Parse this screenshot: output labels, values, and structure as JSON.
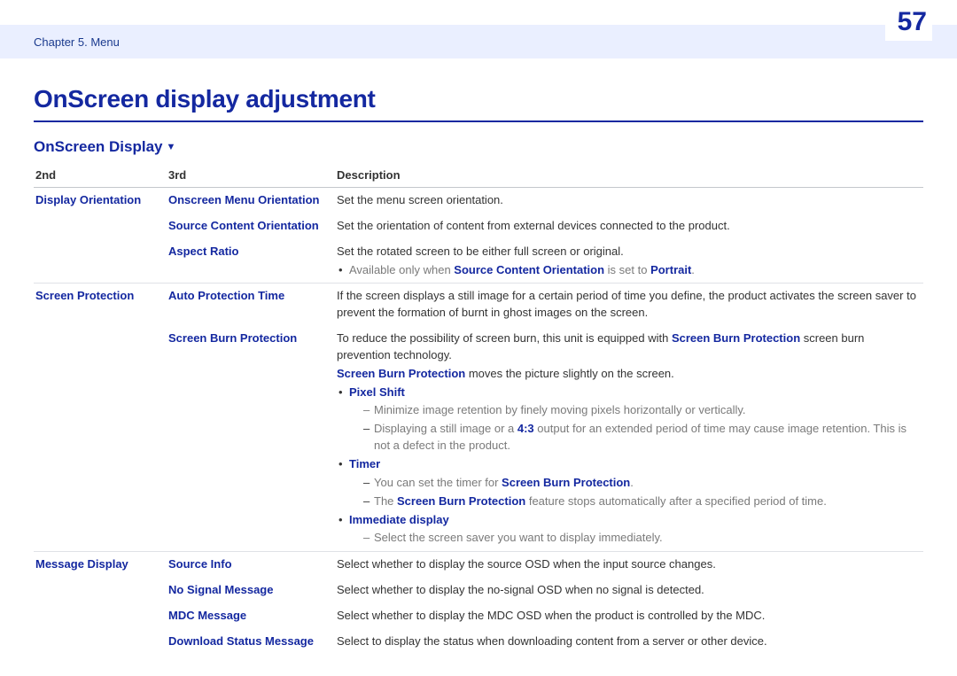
{
  "page_number": "57",
  "breadcrumb": "Chapter 5.  Menu",
  "title": "OnScreen display adjustment",
  "section_title": "OnScreen Display",
  "headers": {
    "c2": "2nd",
    "c3": "3rd",
    "desc": "Description"
  },
  "rows": {
    "display_orientation": {
      "second": "Display Orientation",
      "onscreen_menu": {
        "third": "Onscreen Menu Orientation",
        "desc": "Set the menu screen orientation."
      },
      "source_content": {
        "third": "Source Content Orientation",
        "desc": "Set the orientation of content from external devices connected to the product."
      },
      "aspect_ratio": {
        "third": "Aspect Ratio",
        "desc": "Set the rotated screen to be either full screen or original.",
        "note_prefix": "Available only when ",
        "note_link1": "Source Content Orientation",
        "note_mid": " is set to ",
        "note_link2": "Portrait",
        "note_suffix": "."
      }
    },
    "screen_protection": {
      "second": "Screen Protection",
      "auto_protection": {
        "third": "Auto Protection Time",
        "desc": "If the screen displays a still image for a certain period of time you define, the product activates the screen saver to prevent the formation of burnt in ghost images on the screen."
      },
      "screen_burn": {
        "third": "Screen Burn Protection",
        "p1_pre": "To reduce the possibility of screen burn, this unit is equipped with ",
        "p1_link": "Screen Burn Protection",
        "p1_post": " screen burn prevention technology.",
        "p2_link": "Screen Burn Protection",
        "p2_post": " moves the picture slightly on the screen.",
        "pixel_shift": {
          "label": "Pixel Shift",
          "s1": "Minimize image retention by finely moving pixels horizontally or vertically.",
          "s2_pre": "Displaying a still image or a ",
          "s2_link": "4:3",
          "s2_post": " output for an extended period of time may cause image retention. This is not a defect in the product."
        },
        "timer": {
          "label": "Timer",
          "s1_pre": "You can set the timer for ",
          "s1_link": "Screen Burn Protection",
          "s1_post": ".",
          "s2_pre": "The ",
          "s2_link": "Screen Burn Protection",
          "s2_post": " feature stops automatically after a specified period of time."
        },
        "immediate": {
          "label": "Immediate display",
          "s1": "Select the screen saver you want to display immediately."
        }
      }
    },
    "message_display": {
      "second": "Message Display",
      "source_info": {
        "third": "Source Info",
        "desc": "Select whether to display the source OSD when the input source changes."
      },
      "no_signal": {
        "third": "No Signal Message",
        "desc": "Select whether to display the no-signal OSD when no signal is detected."
      },
      "mdc": {
        "third": "MDC Message",
        "desc": "Select whether to display the MDC OSD when the product is controlled by the MDC."
      },
      "download": {
        "third": "Download Status Message",
        "desc": "Select to display the status when downloading content from a server or other device."
      }
    }
  }
}
